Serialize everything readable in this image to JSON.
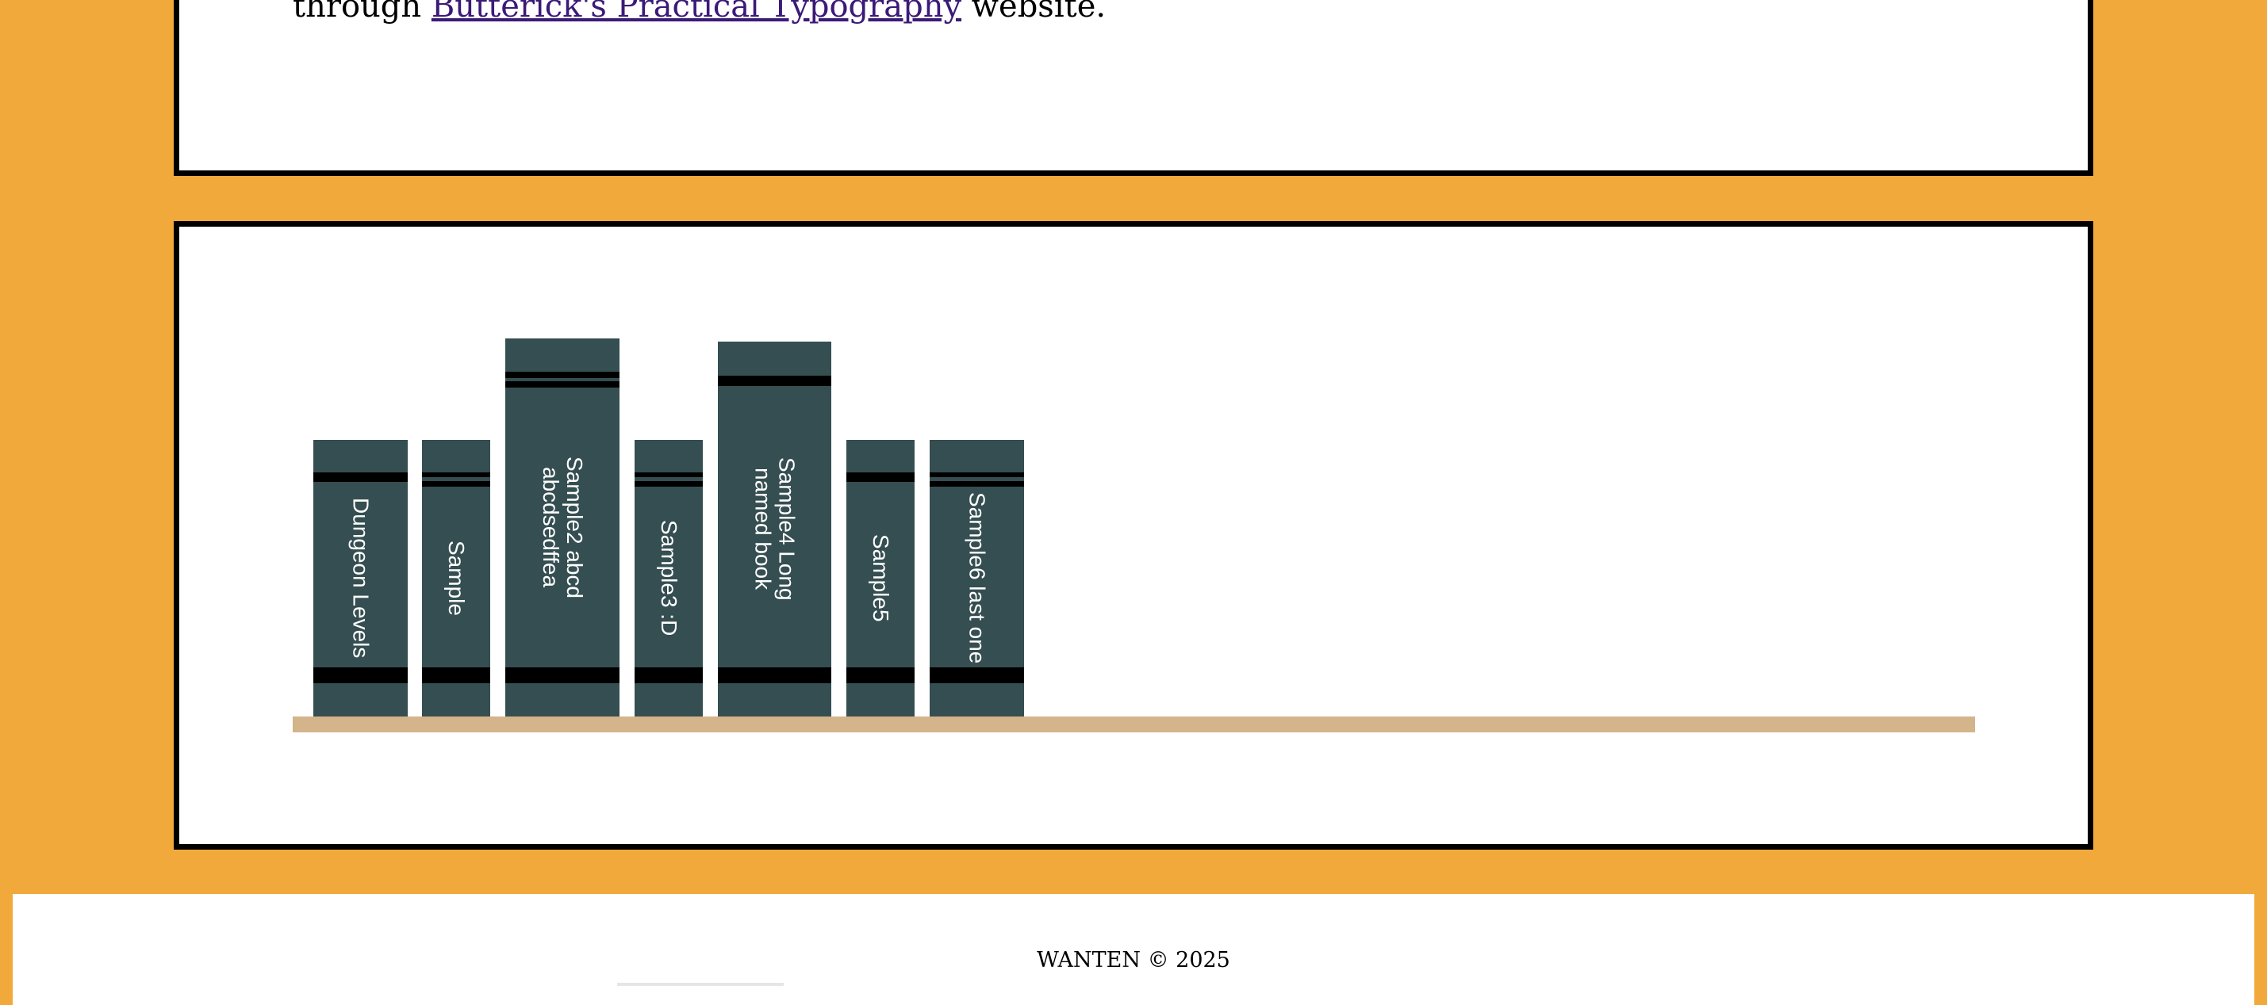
{
  "intro": {
    "text_before": "through ",
    "link_text": "Butterick's Practical Typography",
    "text_after": " website."
  },
  "bookshelf": {
    "books": [
      {
        "title": "Dungeon Levels"
      },
      {
        "title": "Sample"
      },
      {
        "title": "Sample2 abcd abcdsedffea"
      },
      {
        "title": "Sample3 :D"
      },
      {
        "title": "Sample4 Long named book"
      },
      {
        "title": "Sample5"
      },
      {
        "title": "Sample6 last one"
      }
    ]
  },
  "footer": {
    "text": "WANTEN © 2025"
  },
  "colors": {
    "page_background": "#f2a93b",
    "book_cover": "#354e51",
    "shelf": "#d4b48a",
    "link": "#3b1a78"
  }
}
